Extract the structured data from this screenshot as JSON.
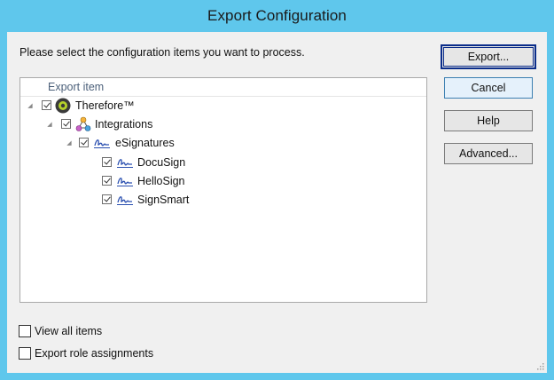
{
  "window": {
    "title": "Export Configuration"
  },
  "prompt": "Please select the configuration items you want to process.",
  "tree": {
    "column_header": "Export item",
    "items": [
      {
        "label": "Therefore™",
        "level": 0,
        "checked": true,
        "icon": "therefore-logo-icon"
      },
      {
        "label": "Integrations",
        "level": 1,
        "checked": true,
        "icon": "integrations-icon"
      },
      {
        "label": "eSignatures",
        "level": 2,
        "checked": true,
        "icon": "signature-icon"
      },
      {
        "label": "DocuSign",
        "level": 3,
        "checked": true,
        "icon": "signature-icon"
      },
      {
        "label": "HelloSign",
        "level": 3,
        "checked": true,
        "icon": "signature-icon"
      },
      {
        "label": "SignSmart",
        "level": 3,
        "checked": true,
        "icon": "signature-icon"
      }
    ]
  },
  "buttons": {
    "export": "Export...",
    "cancel": "Cancel",
    "help": "Help",
    "advanced": "Advanced..."
  },
  "options": {
    "view_all": {
      "label": "View all items",
      "checked": false
    },
    "export_roles": {
      "label": "Export role assignments",
      "checked": false
    }
  },
  "colors": {
    "title_bar": "#5fc7ec",
    "default_button_border": "#0b2d8a"
  }
}
